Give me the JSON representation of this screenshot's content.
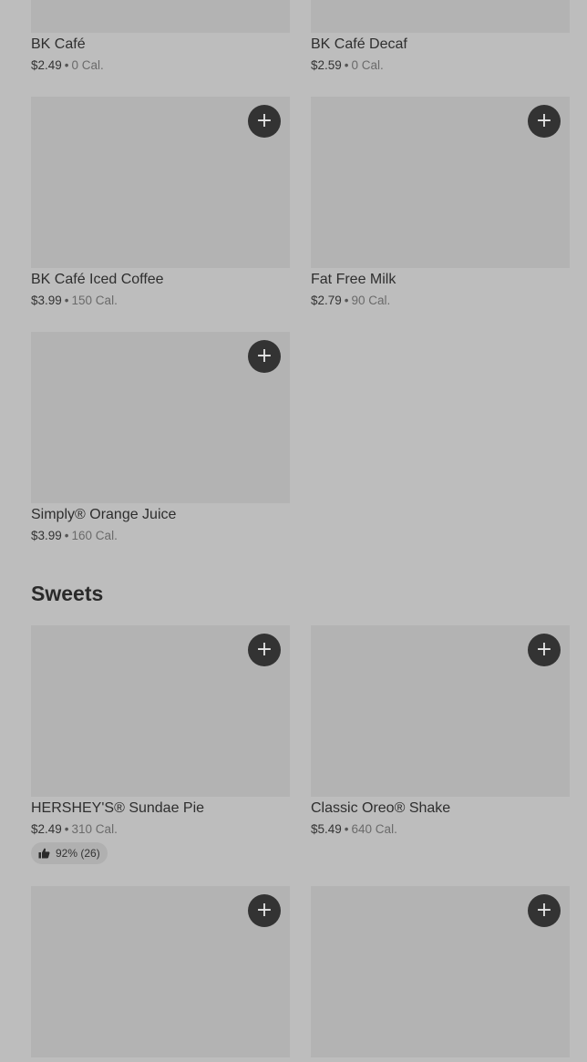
{
  "sections": {
    "sweets_title": "Sweets"
  },
  "icons": {
    "add": "plus-icon",
    "rating": "thumbs-up-icon"
  },
  "items": [
    {
      "name": "BK Café",
      "price": "$2.49",
      "separator": "•",
      "calories": "0 Cal."
    },
    {
      "name": "BK Café Decaf",
      "price": "$2.59",
      "separator": "•",
      "calories": "0 Cal."
    },
    {
      "name": "BK Café Iced Coffee",
      "price": "$3.99",
      "separator": "•",
      "calories": "150 Cal."
    },
    {
      "name": "Fat Free Milk",
      "price": "$2.79",
      "separator": "•",
      "calories": "90 Cal."
    },
    {
      "name": "Simply® Orange Juice",
      "price": "$3.99",
      "separator": "•",
      "calories": "160 Cal."
    },
    {
      "name": "HERSHEY'S® Sundae Pie",
      "price": "$2.49",
      "separator": "•",
      "calories": "310 Cal.",
      "rating": "92% (26)"
    },
    {
      "name": "Classic Oreo® Shake",
      "price": "$5.49",
      "separator": "•",
      "calories": "640 Cal."
    }
  ],
  "add_label": "+"
}
